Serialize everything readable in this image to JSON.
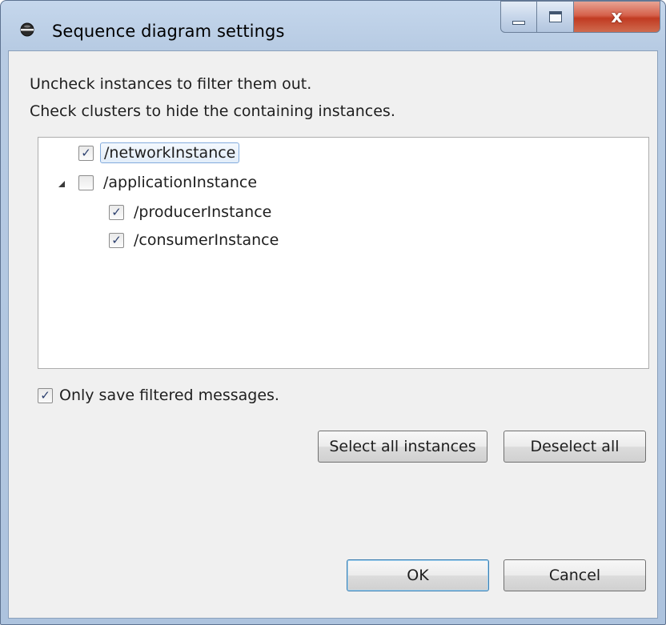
{
  "window": {
    "title": "Sequence diagram settings",
    "close_glyph": "x"
  },
  "instructions": {
    "line1": "Uncheck instances to filter them out.",
    "line2": "Check clusters to hide the containing instances."
  },
  "tree": {
    "items": [
      {
        "label": "/networkInstance",
        "checked": true,
        "selected": true,
        "level": 0
      },
      {
        "label": "/applicationInstance",
        "checked": false,
        "expanded": true,
        "level": 0
      },
      {
        "label": "/producerInstance",
        "checked": true,
        "level": 1
      },
      {
        "label": "/consumerInstance",
        "checked": true,
        "level": 1
      }
    ]
  },
  "options": {
    "only_save_label": "Only save filtered messages.",
    "only_save_checked": true
  },
  "buttons": {
    "select_all": "Select all instances",
    "deselect_all": "Deselect all",
    "ok": "OK",
    "cancel": "Cancel"
  },
  "glyphs": {
    "check": "✓"
  },
  "colors": {
    "title_bar": "#b7cbe3",
    "client_bg": "#f0f0f0",
    "close_button": "#c13b22",
    "default_button_border": "#3c7fb1",
    "selection_border": "#84acdd"
  },
  "icons": {
    "app": "globe-icon",
    "minimize": "minimize-icon",
    "maximize": "maximize-icon",
    "close": "close-icon",
    "expander": "expand-triangle-icon",
    "check": "checkmark-icon"
  }
}
